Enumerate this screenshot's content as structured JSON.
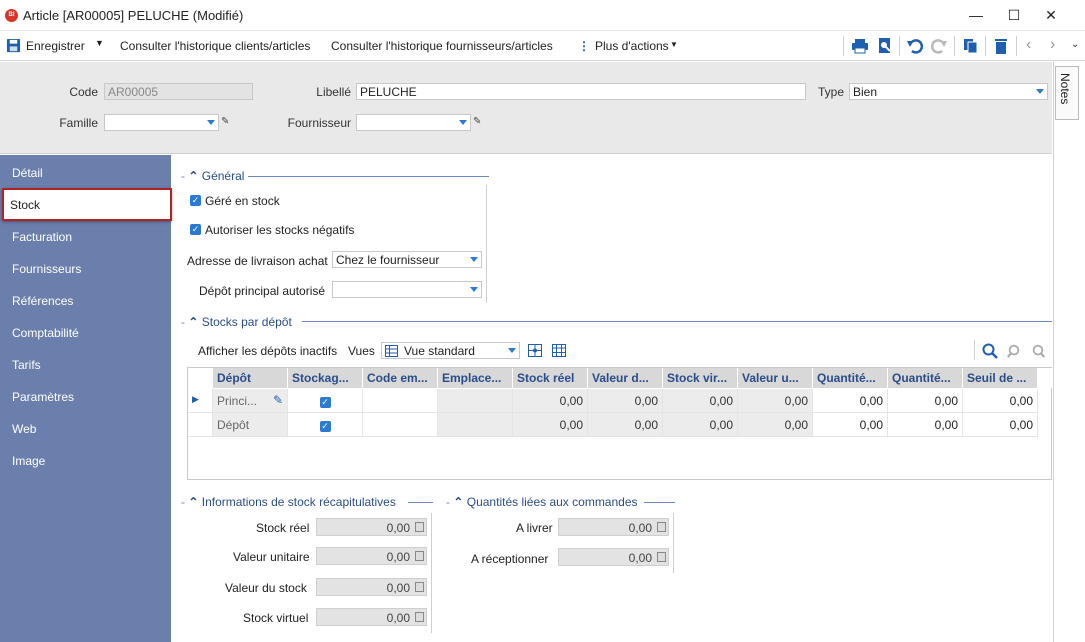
{
  "window": {
    "logo": "BI",
    "title": "Article [AR00005] PELUCHE (Modifié)"
  },
  "toolbar": {
    "save": "Enregistrer",
    "history_clients": "Consulter l'historique clients/articles",
    "history_suppliers": "Consulter l'historique fournisseurs/articles",
    "more_actions": "Plus d'actions"
  },
  "header": {
    "code_label": "Code",
    "code_value": "AR00005",
    "libelle_label": "Libellé",
    "libelle_value": "PELUCHE",
    "type_label": "Type",
    "type_value": "Bien",
    "famille_label": "Famille",
    "fournisseur_label": "Fournisseur"
  },
  "notes_label": "Notes",
  "sidebar": {
    "items": [
      "Détail",
      "Stock",
      "Facturation",
      "Fournisseurs",
      "Références",
      "Comptabilité",
      "Tarifs",
      "Paramètres",
      "Web",
      "Image"
    ]
  },
  "general": {
    "title": "Général",
    "gere_en_stock": "Géré en stock",
    "autoriser_negatifs": "Autoriser les stocks négatifs",
    "adresse_label": "Adresse de livraison achat",
    "adresse_value": "Chez le fournisseur",
    "depot_label": "Dépôt principal autorisé"
  },
  "stocks": {
    "title": "Stocks par dépôt",
    "show_inactive": "Afficher les dépôts inactifs",
    "views_label": "Vues",
    "view_value": "Vue standard",
    "columns": [
      "Dépôt",
      "Stockag...",
      "Code em...",
      "Emplace...",
      "Stock réel",
      "Valeur d...",
      "Stock vir...",
      "Valeur u...",
      "Quantité...",
      "Quantité...",
      "Seuil de ..."
    ],
    "rows": [
      {
        "depot": "Princi...",
        "stock_reel": "0,00",
        "valeur_d": "0,00",
        "stock_vir": "0,00",
        "valeur_u": "0,00",
        "qte1": "0,00",
        "qte2": "0,00",
        "seuil": "0,00"
      },
      {
        "depot": "Dépôt",
        "stock_reel": "0,00",
        "valeur_d": "0,00",
        "stock_vir": "0,00",
        "valeur_u": "0,00",
        "qte1": "0,00",
        "qte2": "0,00",
        "seuil": "0,00"
      }
    ]
  },
  "summary": {
    "title": "Informations de stock récapitulatives",
    "stock_reel_label": "Stock réel",
    "stock_reel": "0,00",
    "valeur_unitaire_label": "Valeur unitaire",
    "valeur_unitaire": "0,00",
    "valeur_stock_label": "Valeur du stock",
    "valeur_stock": "0,00",
    "stock_virtuel_label": "Stock virtuel",
    "stock_virtuel": "0,00"
  },
  "orders": {
    "title": "Quantités liées aux commandes",
    "a_livrer_label": "A livrer",
    "a_livrer": "0,00",
    "a_receptionner_label": "A réceptionner",
    "a_receptionner": "0,00"
  },
  "colors": {
    "sidebar": "#6b7fad",
    "accent": "#2b7bd6",
    "selected_border": "#b22222",
    "section_title": "#2a4d8a"
  }
}
